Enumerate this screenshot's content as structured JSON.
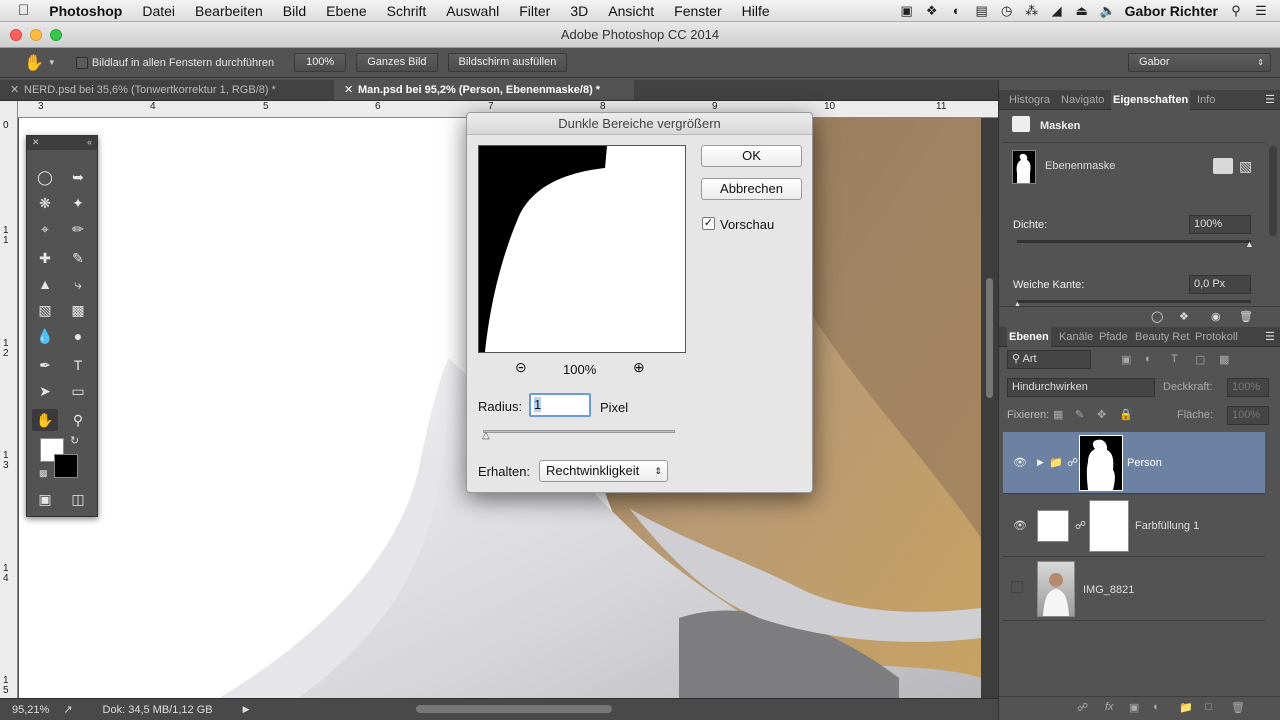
{
  "menubar": {
    "apple": "",
    "app": "Photoshop",
    "items": [
      "Datei",
      "Bearbeiten",
      "Bild",
      "Ebene",
      "Schrift",
      "Auswahl",
      "Filter",
      "3D",
      "Ansicht",
      "Fenster",
      "Hilfe"
    ],
    "user": "Gabor Richter"
  },
  "window": {
    "title": "Adobe Photoshop CC 2014"
  },
  "options": {
    "scroll_all_label": "Bildlauf in allen Fenstern durchführen",
    "zoom100": "100%",
    "fit_screen": "Ganzes Bild",
    "fill_screen": "Bildschirm ausfüllen",
    "workspace": "Gabor"
  },
  "tabs": [
    {
      "label": "NERD.psd bei 35,6% (Tonwertkorrektur 1, RGB/8) *"
    },
    {
      "label": "Man.psd bei 95,2% (Person, Ebenenmaske/8) *"
    }
  ],
  "ruler": {
    "h": [
      "3",
      "4",
      "5",
      "6",
      "7",
      "8",
      "9",
      "10",
      "11"
    ],
    "v": [
      "0",
      "1 1",
      "1 2",
      "1 3",
      "1 4",
      "1 5"
    ]
  },
  "status": {
    "zoom": "95,21%",
    "doc": "Dok: 34,5 MB/1,12 GB"
  },
  "dialog": {
    "title": "Dunkle Bereiche vergrößern",
    "ok": "OK",
    "cancel": "Abbrechen",
    "preview_label": "Vorschau",
    "preview_checked": true,
    "zoom": "100%",
    "radius_label": "Radius:",
    "radius_value": "1",
    "radius_unit": "Pixel",
    "preserve_label": "Erhalten:",
    "preserve_value": "Rechtwinkligkeit"
  },
  "properties": {
    "tabs": [
      "Histogra",
      "Navigato",
      "Eigenschaften",
      "Info"
    ],
    "section": "Masken",
    "mask_label": "Ebenenmaske",
    "density_label": "Dichte:",
    "density_value": "100%",
    "feather_label": "Weiche Kante:",
    "feather_value": "0,0 Px"
  },
  "layers_panel": {
    "tabs": [
      "Ebenen",
      "Kanäle",
      "Pfade",
      "Beauty Ret",
      "Protokoll"
    ],
    "filter": "Art",
    "blend_mode": "Hindurchwirken",
    "opacity_label": "Deckkraft:",
    "opacity_value": "100%",
    "lock_label": "Fixieren:",
    "fill_label": "Fläche:",
    "fill_value": "100%",
    "layers": [
      {
        "name": "Person",
        "selected": true,
        "visible": true
      },
      {
        "name": "Farbfüllung 1",
        "selected": false,
        "visible": true
      },
      {
        "name": "IMG_8821",
        "selected": false,
        "visible": false
      }
    ]
  },
  "colors": {
    "accent": "#6d81a3",
    "panel": "#535353",
    "dialog": "#e6e6e6"
  }
}
